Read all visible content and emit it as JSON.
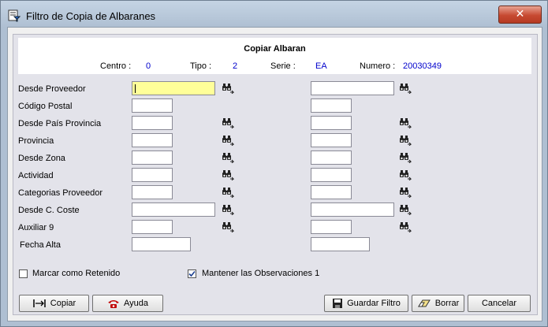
{
  "window": {
    "title": "Filtro de Copia de Albaranes",
    "close_glyph": "✕"
  },
  "header": {
    "title": "Copiar Albaran",
    "centro_label": "Centro :",
    "centro_value": "0",
    "tipo_label": "Tipo :",
    "tipo_value": "2",
    "serie_label": "Serie :",
    "serie_value": "EA",
    "numero_label": "Numero :",
    "numero_value": "20030349"
  },
  "fields": [
    {
      "label": "Desde Proveedor"
    },
    {
      "label": "Código Postal"
    },
    {
      "label": "Desde País Provincia"
    },
    {
      "label": "Provincia"
    },
    {
      "label": "Desde Zona"
    },
    {
      "label": "Actividad"
    },
    {
      "label": "Categorias Proveedor"
    },
    {
      "label": "Desde C. Coste"
    },
    {
      "label": "Auxiliar 9"
    },
    {
      "label": "Fecha Alta"
    }
  ],
  "options": {
    "retenido": {
      "label": "Marcar como Retenido",
      "checked": false
    },
    "observaciones": {
      "label": "Mantener las Observaciones 1",
      "checked": true
    }
  },
  "buttons": {
    "copiar": "Copiar",
    "ayuda": "Ayuda",
    "guardar_filtro": "Guardar Filtro",
    "borrar": "Borrar",
    "cancelar": "Cancelar"
  },
  "icons": [
    "window-filter-icon",
    "binoculars-icon",
    "copy-arrows-icon",
    "help-phone-icon",
    "save-disk-icon",
    "eraser-icon"
  ],
  "colors": {
    "active_field": "#ffff99",
    "value_text": "#0000cc",
    "close_button": "#c74a32"
  }
}
